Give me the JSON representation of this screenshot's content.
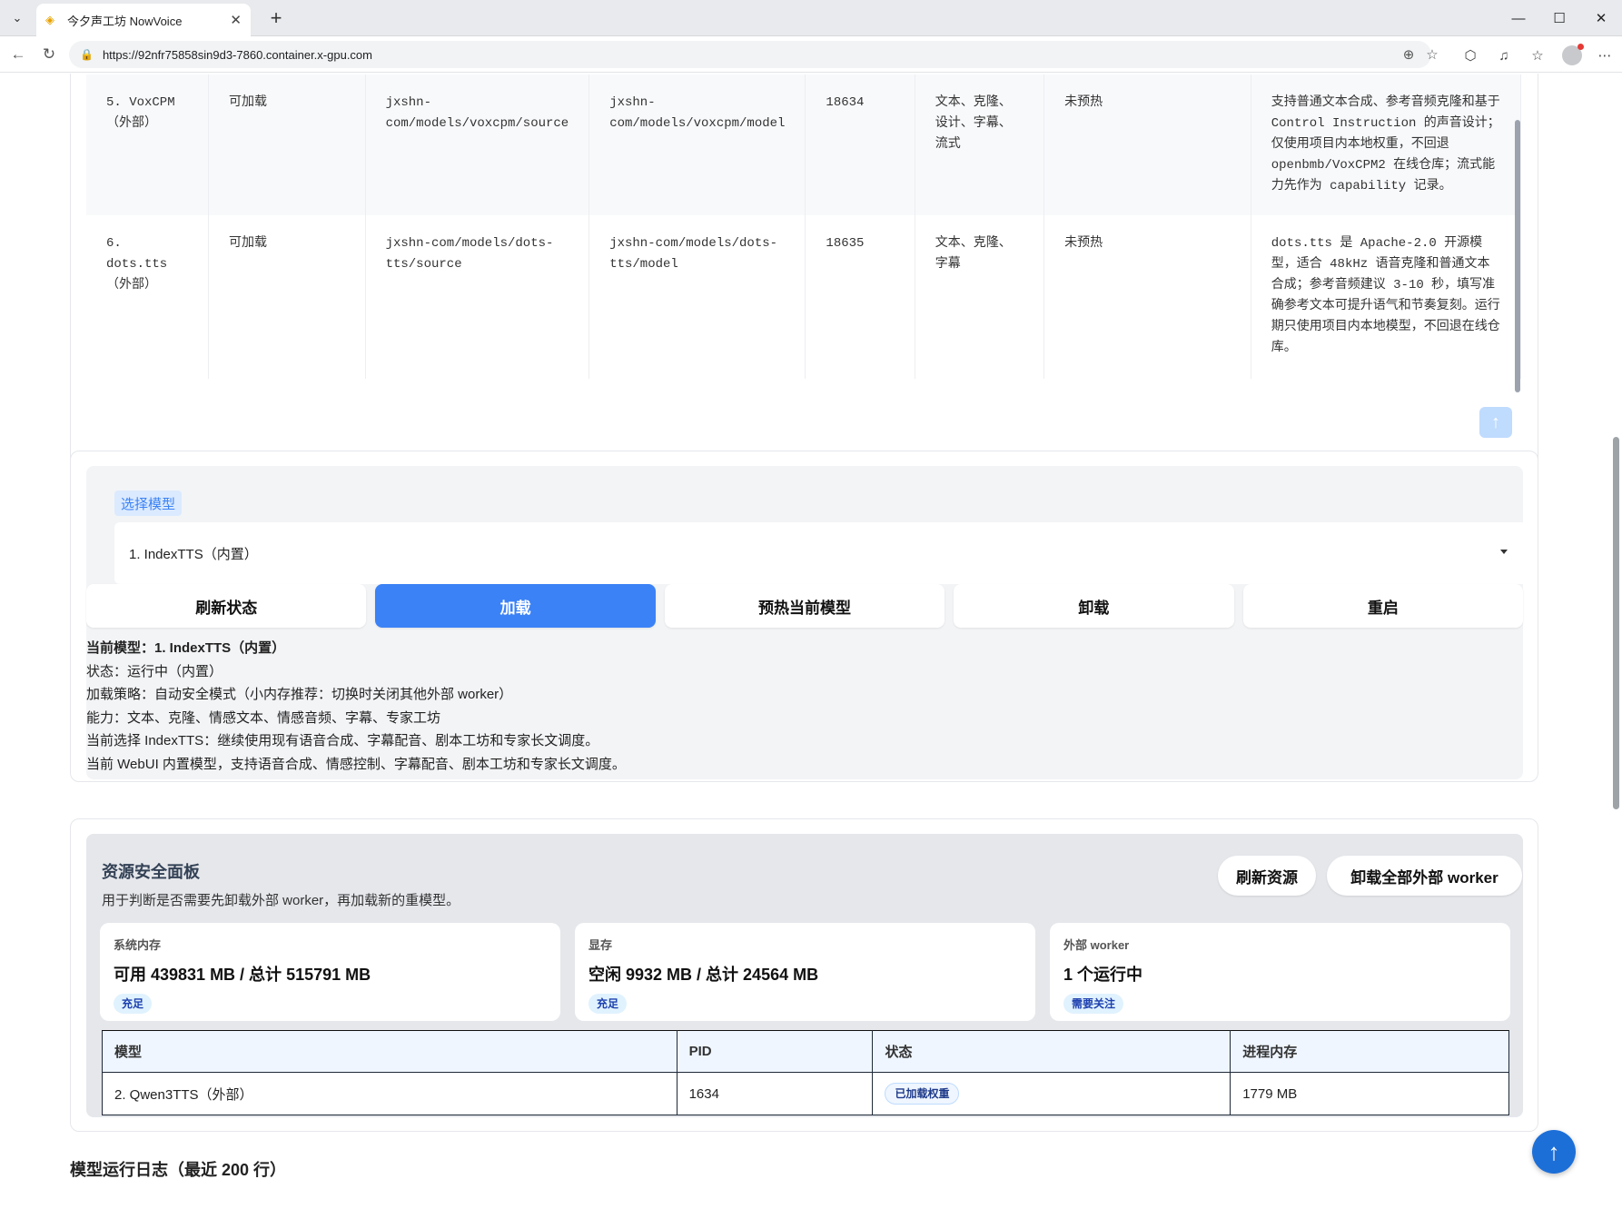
{
  "browser": {
    "tab_title": "今夕声工坊 NowVoice",
    "url": "https://92nfr75858sin9d3-7860.container.x-gpu.com"
  },
  "model_table": {
    "rows": [
      {
        "name": "5. VoxCPM（外部）",
        "status": "可加载",
        "source": "jxshn-com/models/voxcpm/source",
        "model_path": "jxshn-com/models/voxcpm/model",
        "port": "18634",
        "capabilities": "文本、克隆、设计、字幕、流式",
        "warmup": "未预热",
        "notes": "支持普通文本合成、参考音频克隆和基于 Control Instruction 的声音设计；仅使用项目内本地权重，不回退 openbmb/VoxCPM2 在线仓库；流式能力先作为 capability 记录。"
      },
      {
        "name": "6. dots.tts（外部）",
        "status": "可加载",
        "source": "jxshn-com/models/dots-tts/source",
        "model_path": "jxshn-com/models/dots-tts/model",
        "port": "18635",
        "capabilities": "文本、克隆、字幕",
        "warmup": "未预热",
        "notes": "dots.tts 是 Apache-2.0 开源模型，适合 48kHz 语音克隆和普通文本合成；参考音频建议 3-10 秒，填写准确参考文本可提升语气和节奏复刻。运行期只使用项目内本地模型，不回退在线仓库。"
      }
    ]
  },
  "model_select": {
    "label": "选择模型",
    "selected": "1. IndexTTS（内置）",
    "buttons": {
      "refresh": "刷新状态",
      "load": "加载",
      "warmup": "预热当前模型",
      "unload": "卸载",
      "restart": "重启"
    },
    "info": {
      "current": "当前模型：1. IndexTTS（内置）",
      "status": "状态：运行中（内置）",
      "strategy": "加载策略：自动安全模式（小内存推荐：切换时关闭其他外部 worker）",
      "capability": "能力：文本、克隆、情感文本、情感音频、字幕、专家工坊",
      "selection": "当前选择 IndexTTS：继续使用现有语音合成、字幕配音、剧本工坊和专家长文调度。",
      "builtin": "当前 WebUI 内置模型，支持语音合成、情感控制、字幕配音、剧本工坊和专家长文调度。"
    }
  },
  "resource_panel": {
    "title": "资源安全面板",
    "subtitle": "用于判断是否需要先卸载外部 worker，再加载新的重模型。",
    "refresh_button": "刷新资源",
    "unload_all_button": "卸载全部外部 worker",
    "stats": [
      {
        "label": "系统内存",
        "value": "可用 439831 MB / 总计 515791 MB",
        "badge": "充足"
      },
      {
        "label": "显存",
        "value": "空闲 9932 MB / 总计 24564 MB",
        "badge": "充足"
      },
      {
        "label": "外部 worker",
        "value": "1 个运行中",
        "badge": "需要关注"
      }
    ],
    "table": {
      "headers": [
        "模型",
        "PID",
        "状态",
        "进程内存"
      ],
      "rows": [
        {
          "model": "2. Qwen3TTS（外部）",
          "pid": "1634",
          "status": "已加载权重",
          "memory": "1779 MB"
        }
      ]
    }
  },
  "log_title": "模型运行日志（最近 200 行）",
  "icons": {
    "favicon": "nowvoice-icon",
    "back": "arrow-left-icon",
    "reload": "reload-icon",
    "lock": "lock-icon",
    "zoom": "zoom-icon",
    "favorite": "star-icon",
    "to_top": "arrow-up-icon"
  }
}
